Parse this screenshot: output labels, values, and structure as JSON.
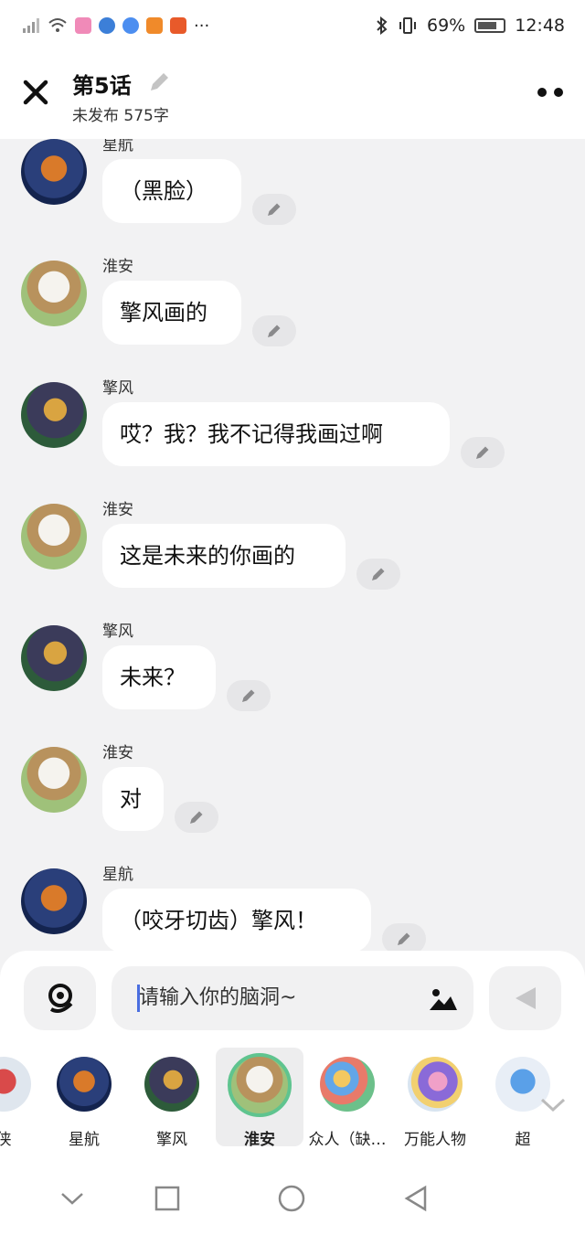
{
  "status_bar": {
    "battery": "69%",
    "time": "12:48",
    "more": "···"
  },
  "header": {
    "title": "第5话",
    "subtitle": "未发布 575字"
  },
  "messages": [
    {
      "name": "星航",
      "text": "（黑脸）",
      "avatar": "xinghang"
    },
    {
      "name": "淮安",
      "text": "擎风画的",
      "avatar": "huaian"
    },
    {
      "name": "擎风",
      "text": "哎？我？我不记得我画过啊",
      "avatar": "qingfeng"
    },
    {
      "name": "淮安",
      "text": "这是未来的你画的",
      "avatar": "huaian"
    },
    {
      "name": "擎风",
      "text": "未来？",
      "avatar": "qingfeng"
    },
    {
      "name": "淮安",
      "text": "对",
      "avatar": "huaian"
    },
    {
      "name": "星航",
      "text": "（咬牙切齿）擎风！",
      "avatar": "xinghang"
    }
  ],
  "input": {
    "placeholder": "请输入你的脑洞~"
  },
  "characters": [
    {
      "label": "侠",
      "avatar": "red"
    },
    {
      "label": "星航",
      "avatar": "xinghang"
    },
    {
      "label": "擎风",
      "avatar": "qingfeng"
    },
    {
      "label": "淮安",
      "avatar": "huaian",
      "selected": true
    },
    {
      "label": "众人（缺…",
      "avatar": "crowd"
    },
    {
      "label": "万能人物",
      "avatar": "wanneng"
    },
    {
      "label": "超",
      "avatar": "blue"
    }
  ],
  "icons": {
    "close": "close-icon",
    "title_edit": "pencil-icon",
    "more": "more-dots-icon",
    "message_edit": "pencil-icon",
    "voice": "voice-icon",
    "image": "image-icon",
    "send": "send-icon",
    "expand": "chevron-down-icon"
  },
  "colors": {
    "selected_ring": "#5fc48f",
    "caret": "#4a6ee0",
    "chat_background": "#f2f2f3"
  }
}
